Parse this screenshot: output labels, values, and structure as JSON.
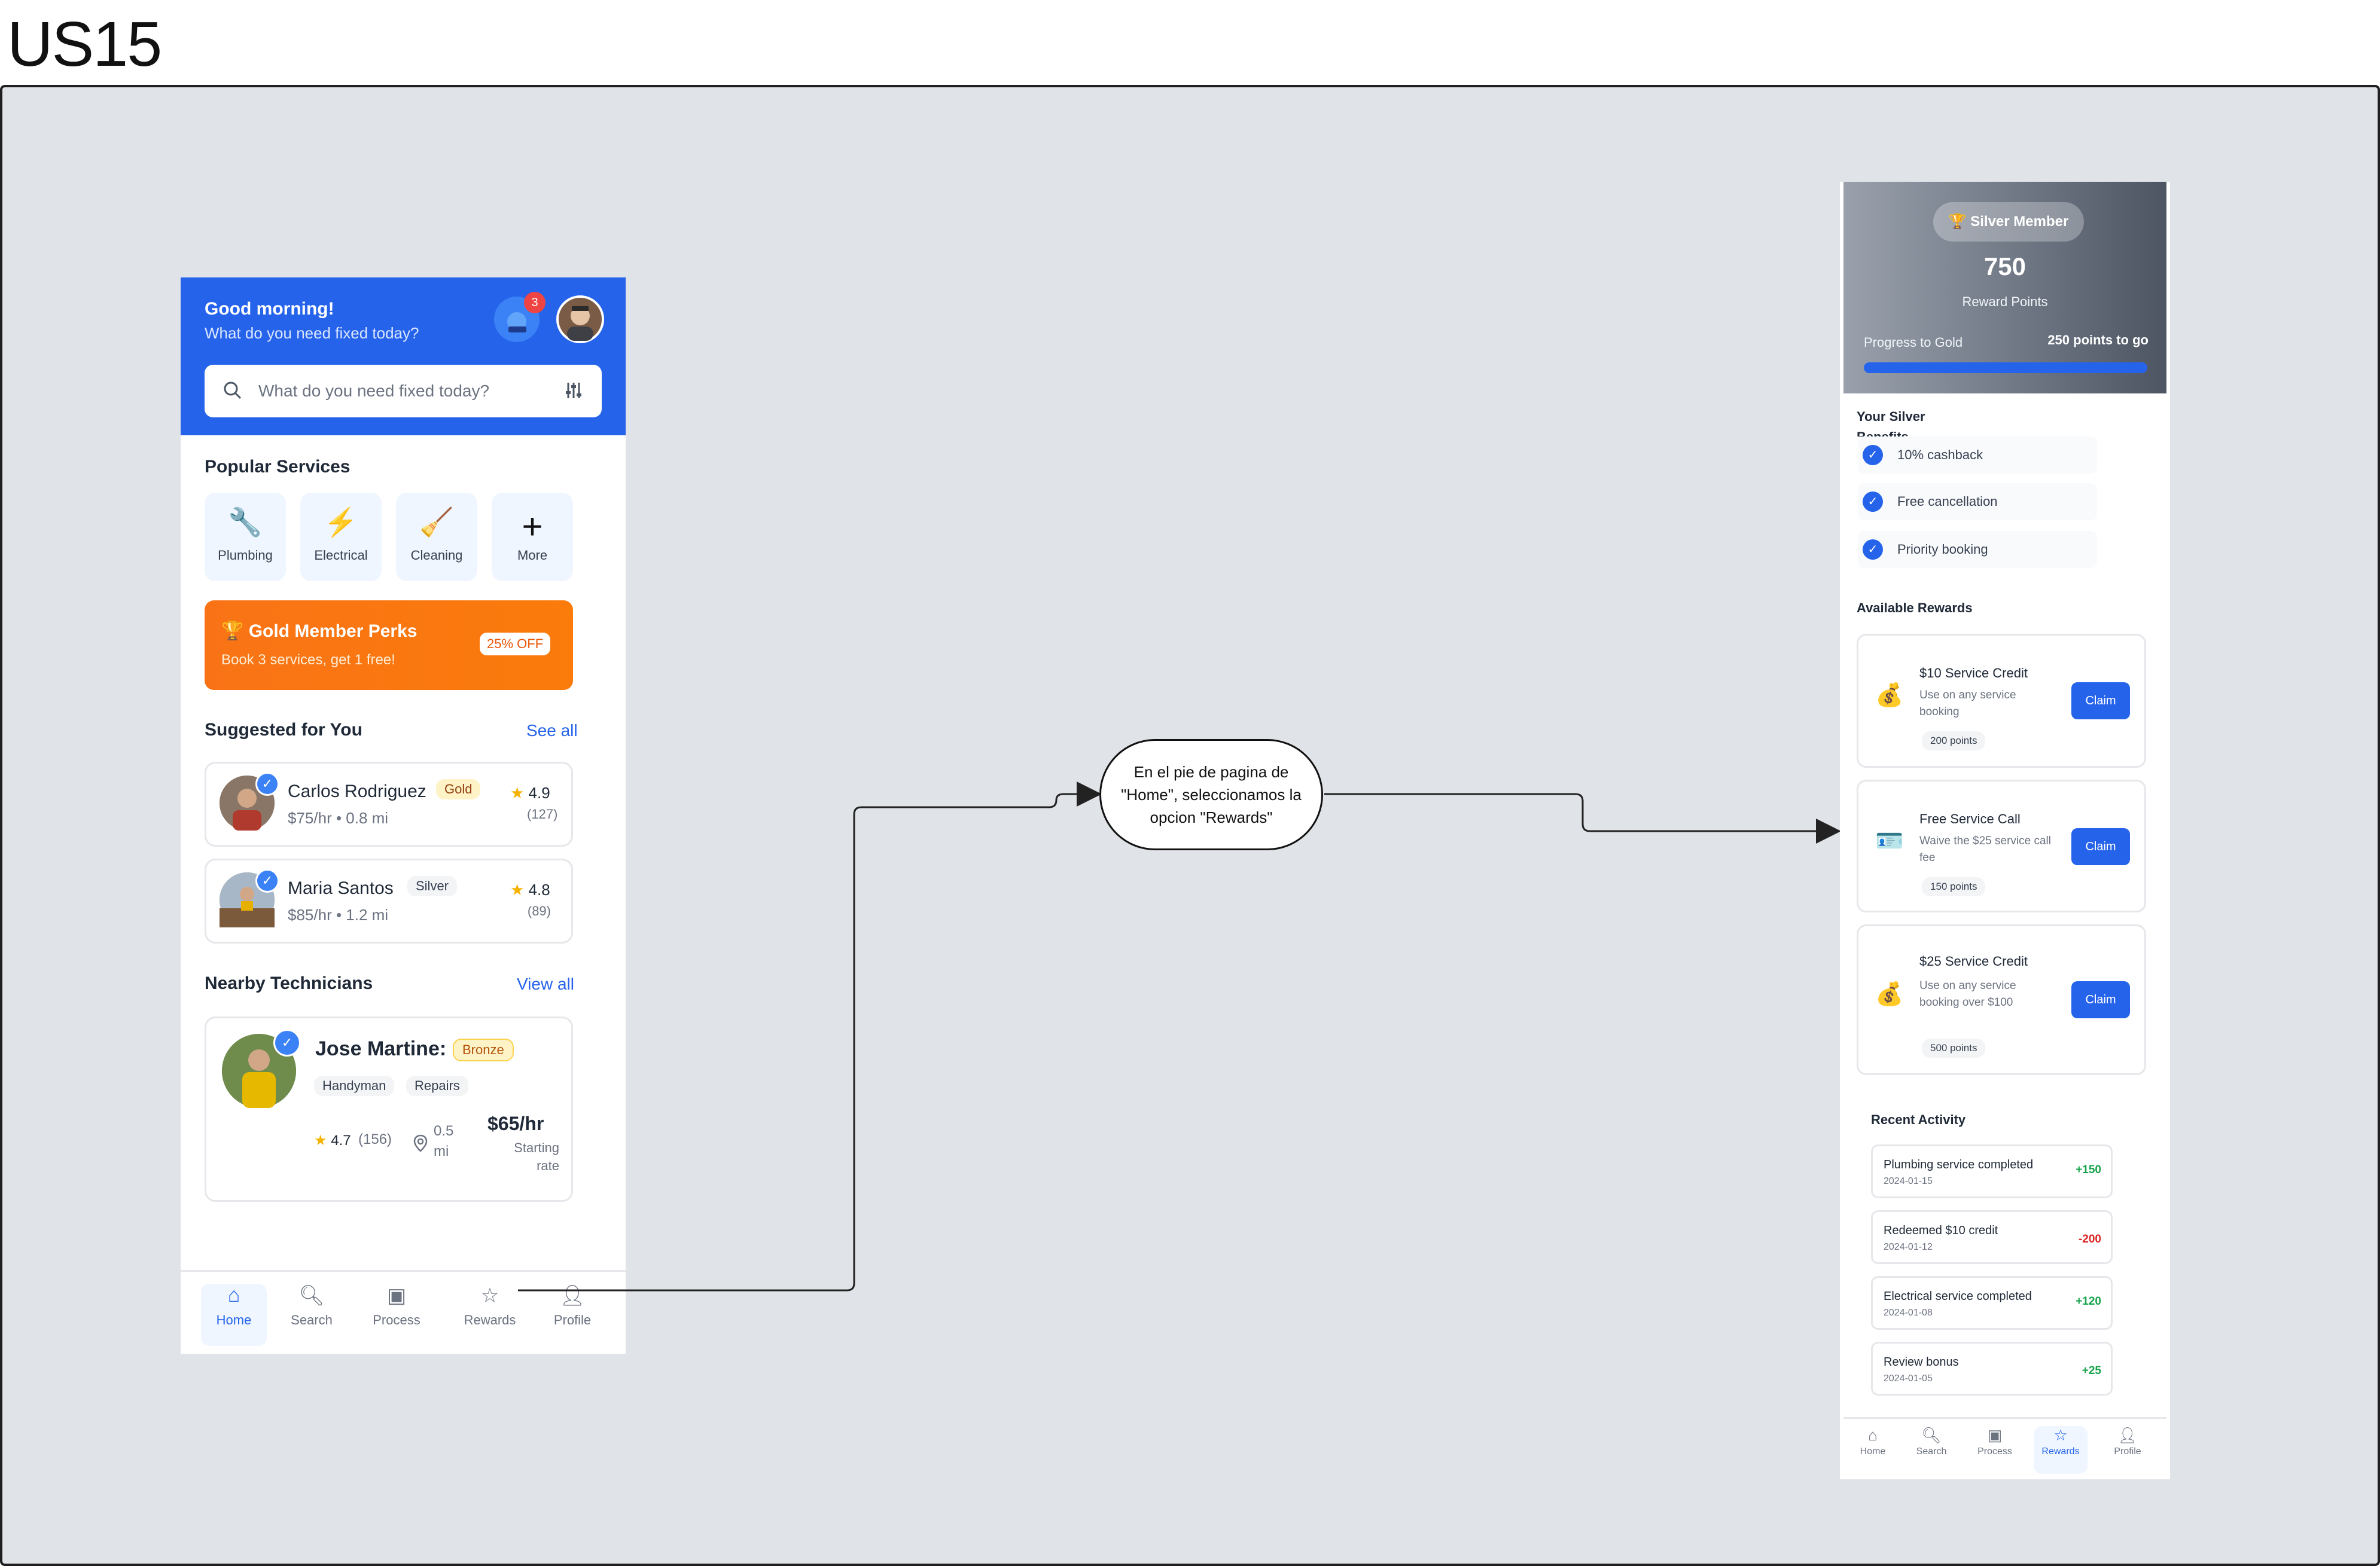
{
  "page": {
    "title": "US15"
  },
  "home": {
    "greeting": "Good morning!",
    "subtitle": "What do you need fixed today?",
    "notification_count": "3",
    "search_placeholder": "What do you need fixed today?",
    "popular_title": "Popular Services",
    "services": [
      {
        "label": "Plumbing",
        "icon": "wrench-icon",
        "glyph": "🔧"
      },
      {
        "label": "Electrical",
        "icon": "lightning-icon",
        "glyph": "⚡"
      },
      {
        "label": "Cleaning",
        "icon": "broom-icon",
        "glyph": "🧹"
      },
      {
        "label": "More",
        "icon": "plus-icon",
        "glyph": "+"
      }
    ],
    "promo": {
      "title": "Gold Member Perks",
      "subtitle": "Book 3 services, get 1 free!",
      "badge": "25% OFF"
    },
    "suggested_title": "Suggested for You",
    "see_all": "See all",
    "suggested": [
      {
        "name": "Carlos Rodriguez",
        "tier": "Gold",
        "meta": "$75/hr • 0.8 mi",
        "rating": "4.9",
        "count": "(127)"
      },
      {
        "name": "Maria Santos",
        "tier": "Silver",
        "meta": "$85/hr • 1.2 mi",
        "rating": "4.8",
        "count": "(89)"
      }
    ],
    "nearby_title": "Nearby Technicians",
    "view_all": "View all",
    "nearby": {
      "name": "Jose Martine:",
      "tier": "Bronze",
      "tags": [
        "Handyman",
        "Repairs"
      ],
      "rating": "4.7",
      "count": "(156)",
      "distance": "0.5 mi",
      "price": "$65/hr",
      "price_label": "Starting rate"
    },
    "nav": [
      "Home",
      "Search",
      "Process",
      "Rewards",
      "Profile"
    ]
  },
  "callout": {
    "text": "En el pie de pagina de \"Home\", seleccionamos la opcion \"Rewards\""
  },
  "rewards": {
    "member": "Silver Member",
    "points": "750",
    "points_label": "Reward Points",
    "progress_label": "Progress to Gold",
    "progress_remaining": "250 points to go",
    "progress_fraction": 1.0,
    "benefits_title": "Your Silver Benefits",
    "benefits": [
      "10% cashback",
      "Free cancellation",
      "Priority booking"
    ],
    "available_title": "Available Rewards",
    "items": [
      {
        "icon": "money-bag-icon",
        "glyph": "💰",
        "title": "$10 Service Credit",
        "desc": "Use on any service booking",
        "points": "200 points",
        "action": "Claim"
      },
      {
        "icon": "id-card-icon",
        "glyph": "🪪",
        "title": "Free Service Call",
        "desc": "Waive the $25 service call fee",
        "points": "150 points",
        "action": "Claim"
      },
      {
        "icon": "money-bag-icon",
        "glyph": "💰",
        "title": "$25 Service Credit",
        "desc": "Use on any service booking over $100",
        "points": "500 points",
        "action": "Claim"
      }
    ],
    "recent_title": "Recent Activity",
    "activity": [
      {
        "title": "Plumbing service completed",
        "date": "2024-01-15",
        "value": "+150",
        "type": "pos"
      },
      {
        "title": "Redeemed $10 credit",
        "date": "2024-01-12",
        "value": "-200",
        "type": "neg"
      },
      {
        "title": "Electrical service completed",
        "date": "2024-01-08",
        "value": "+120",
        "type": "pos"
      },
      {
        "title": "Review bonus",
        "date": "2024-01-05",
        "value": "+25",
        "type": "pos"
      }
    ],
    "nav": [
      "Home",
      "Search",
      "Process",
      "Rewards",
      "Profile"
    ]
  },
  "colors": {
    "primary": "#2563eb",
    "orange": "#f97316",
    "canvas": "#e0e3e8"
  }
}
